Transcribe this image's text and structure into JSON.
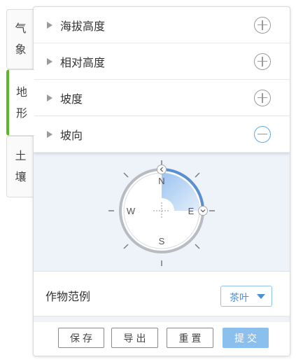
{
  "side_tabs": [
    {
      "chars": [
        "气",
        "象"
      ]
    },
    {
      "chars": [
        "地",
        "形"
      ]
    },
    {
      "chars": [
        "土",
        "壤"
      ]
    }
  ],
  "rows": [
    {
      "label": "海拔高度",
      "icon": "plus-circle-icon"
    },
    {
      "label": "相对高度",
      "icon": "plus-circle-icon"
    },
    {
      "label": "坡度",
      "icon": "plus-circle-icon"
    },
    {
      "label": "坡向",
      "icon": "minus-circle-icon"
    }
  ],
  "compass": {
    "north": "N",
    "east": "E",
    "south": "S",
    "west": "W",
    "selected_from_deg": 0,
    "selected_to_deg": 90,
    "accent": "#5a8fd0"
  },
  "crop": {
    "label": "作物范例",
    "value": "茶叶"
  },
  "buttons": {
    "save": "保存",
    "export": "导出",
    "reset": "重置",
    "submit": "提交"
  },
  "colors": {
    "active_tab": "#5cb82b",
    "minus_icon": "#5ea8e6",
    "submit_bg": "#8bbfee"
  }
}
